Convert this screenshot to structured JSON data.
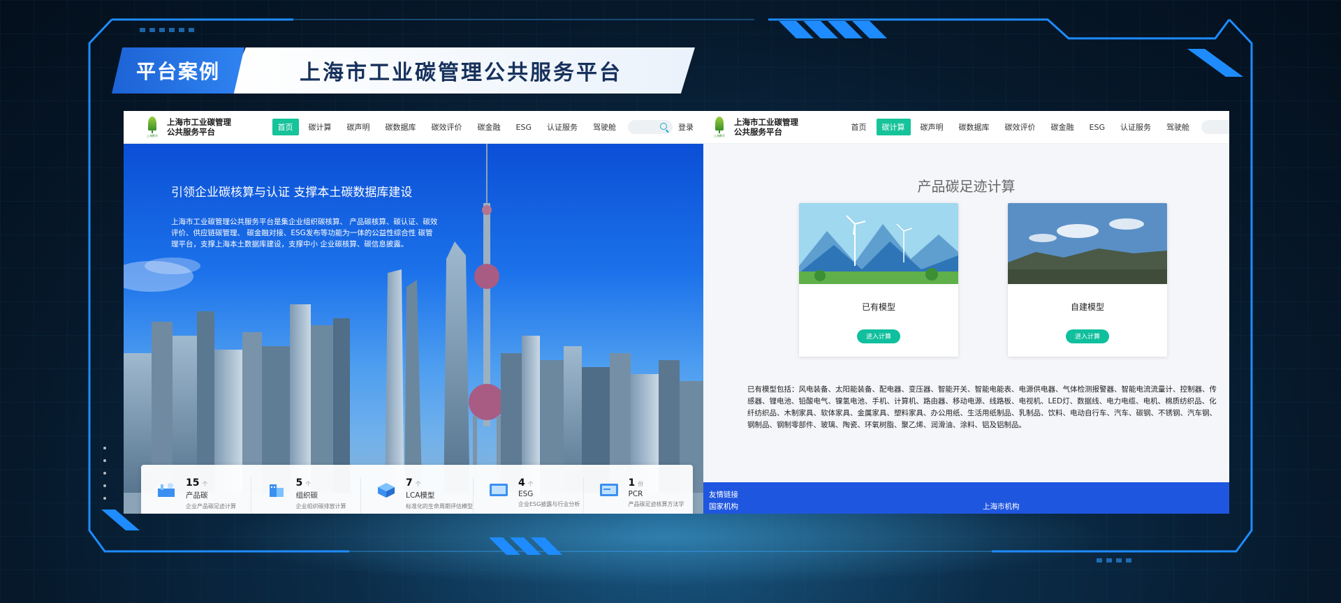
{
  "banner": {
    "tag": "平台案例",
    "title": "上海市工业碳管理公共服务平台"
  },
  "left_screen": {
    "logo_text": "上海市工业碳管理公共服务平台",
    "logo_caption": "上海数字",
    "nav": [
      "首页",
      "碳计算",
      "碳声明",
      "碳数据库",
      "碳效评价",
      "碳金融",
      "ESG",
      "认证服务",
      "驾驶舱"
    ],
    "active_nav": "首页",
    "login": "登录",
    "hero_title": "引领企业碳核算与认证 支撑本土碳数据库建设",
    "hero_desc": "上海市工业碳管理公共服务平台是集企业组织碳核算、 产品碳核算、碳认证、碳效评价、供应链碳管理、 碳金融对接、ESG发布等功能为一体的公益性综合性 碳管理平台，支撑上海本土数据库建设，支撑中小 企业碳核算、碳信息披露。",
    "stats": [
      {
        "number": "15",
        "arrow": "个",
        "name": "产品碳",
        "sub": "企业产品碳足迹计算",
        "icon": "factory-icon"
      },
      {
        "number": "5",
        "arrow": "个",
        "name": "组织碳",
        "sub": "企业组织碳排放计算",
        "icon": "building-icon"
      },
      {
        "number": "7",
        "arrow": "个",
        "name": "LCA模型",
        "sub": "标准化的生命周期评估模型",
        "icon": "cube-icon"
      },
      {
        "number": "4",
        "arrow": "个",
        "name": "ESG",
        "sub": "企业ESG披露与行业分析",
        "icon": "esg-icon"
      },
      {
        "number": "1",
        "arrow": "份",
        "name": "PCR",
        "sub": "产品碳足迹核算方法学",
        "icon": "pcr-icon"
      }
    ]
  },
  "right_screen": {
    "logo_text": "上海市工业碳管理公共服务平台",
    "logo_caption": "上海数字",
    "nav": [
      "首页",
      "碳计算",
      "碳声明",
      "碳数据库",
      "碳效评价",
      "碳金融",
      "ESG",
      "认证服务",
      "驾驶舱"
    ],
    "active_nav": "碳计算",
    "page_title": "产品碳足迹计算",
    "cards": [
      {
        "label": "已有模型",
        "button": "进入计算",
        "image": "wind-turbine-landscape"
      },
      {
        "label": "自建模型",
        "button": "进入计算",
        "image": "mountain-landscape"
      }
    ],
    "model_list": "已有模型包括：风电装备、太阳能装备、配电器、变压器、智能开关、智能电能表、电源供电器、气体检测报警器、智能电流流量计、控制器、传感器、锂电池、铅酸电气、镍氢电池、手机、计算机、路由器、移动电源、线路板、电视机、LED灯、数据线、电力电缆、电机、棉质纺织品、化纤纺织品、木制家具、软体家具、金属家具、塑料家具、办公用纸、生活用纸制品、乳制品、饮料、电动自行车、汽车、碳钢、不锈钢、汽车钢、钢制品、钢制零部件、玻璃、陶瓷、环氧树脂、聚乙烯、润滑油、涂料、铝及铝制品。",
    "footer": {
      "title": "友情链接",
      "col1": "国家机构",
      "col2": "上海市机构"
    }
  },
  "colors": {
    "accent": "#16c39a",
    "brand_blue": "#1f56e0",
    "frame": "#1e8cff"
  }
}
